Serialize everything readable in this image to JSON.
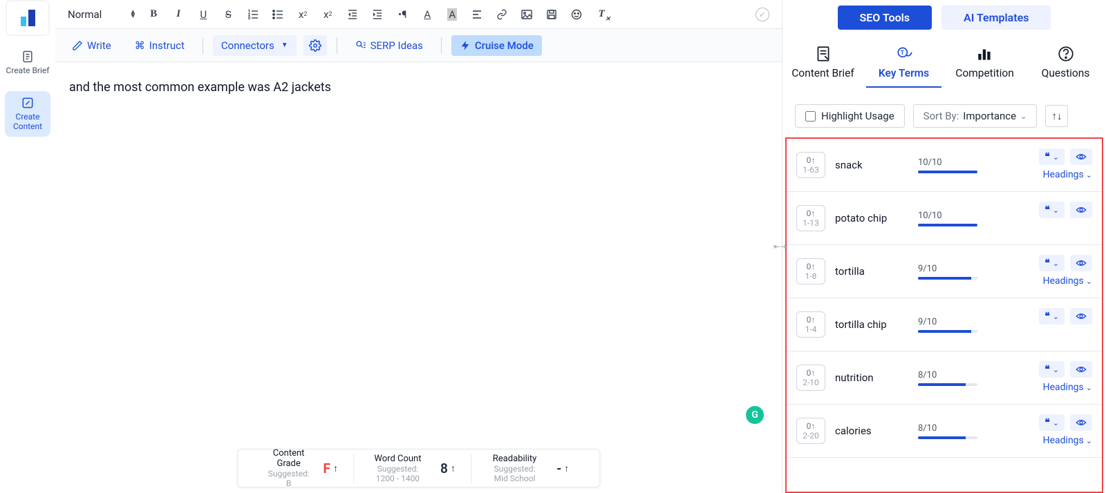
{
  "left_rail": {
    "create_brief": "Create Brief",
    "create_content": "Create Content"
  },
  "format_bar": {
    "style_select": "Normal"
  },
  "action_bar": {
    "write": "Write",
    "instruct": "Instruct",
    "connectors": "Connectors",
    "serp_ideas": "SERP Ideas",
    "cruise_mode": "Cruise Mode"
  },
  "editor": {
    "content": "and the most common example was A2 jackets"
  },
  "grammarly": "G",
  "stats": {
    "content_grade": {
      "label": "Content Grade",
      "suggested": "Suggested: B",
      "value": "F"
    },
    "word_count": {
      "label": "Word Count",
      "suggested": "Suggested: 1200 - 1400",
      "value": "8"
    },
    "readability": {
      "label": "Readability",
      "suggested": "Suggested: Mid School",
      "value": "-"
    }
  },
  "right": {
    "pill_seo": "SEO Tools",
    "pill_ai": "AI Templates",
    "tabs": {
      "brief": "Content Brief",
      "keyterms": "Key Terms",
      "competition": "Competition",
      "questions": "Questions"
    },
    "highlight_usage": "Highlight Usage",
    "sort_label": "Sort By:",
    "sort_value": "Importance",
    "headings_label": "Headings",
    "terms": [
      {
        "count": "0↑",
        "range": "1-63",
        "name": "snack",
        "score": "10/10",
        "fill": 100,
        "headings": true
      },
      {
        "count": "0↑",
        "range": "1-13",
        "name": "potato chip",
        "score": "10/10",
        "fill": 100,
        "headings": false
      },
      {
        "count": "0↑",
        "range": "1-8",
        "name": "tortilla",
        "score": "9/10",
        "fill": 90,
        "headings": true
      },
      {
        "count": "0↑",
        "range": "1-4",
        "name": "tortilla chip",
        "score": "9/10",
        "fill": 90,
        "headings": false
      },
      {
        "count": "0↑",
        "range": "2-10",
        "name": "nutrition",
        "score": "8/10",
        "fill": 80,
        "headings": true
      },
      {
        "count": "0↑",
        "range": "2-20",
        "name": "calories",
        "score": "8/10",
        "fill": 80,
        "headings": true
      }
    ]
  }
}
